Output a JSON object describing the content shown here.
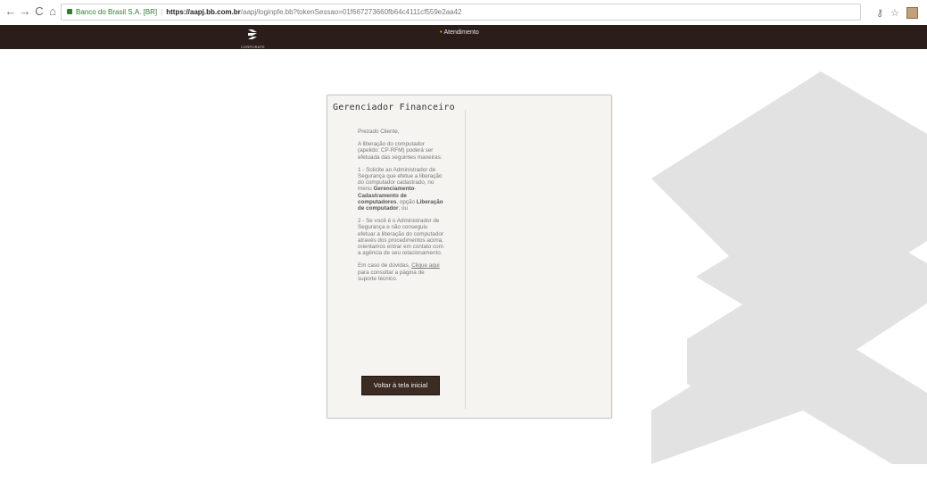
{
  "browser": {
    "back_icon": "←",
    "forward_icon": "→",
    "reload_icon": "C",
    "home_icon": "⌂",
    "site_identity": "Banco do Brasil S.A. [BR]",
    "url_host": "https://aapj.bb.com.br",
    "url_path": "/aapj/loginpfe.bb?tokenSessao=01f667273660fb64c4111cf559e2aa42",
    "key_icon": "⚷",
    "star_icon": "☆",
    "extension_icon": "extension-icon"
  },
  "header": {
    "logo_text": "CORPORATE",
    "menu_item": "Atendimento",
    "bg_color": "#2b1e1a",
    "accent_color": "#e7c300"
  },
  "panel": {
    "title": "Gerenciador Financeiro",
    "greeting": "Prezado Cliente,",
    "intro": "A liberação do computador (apelido: CP-RFM) poderá ser efetuada das seguintes maneiras:",
    "option1_a": "1 - Solicite ao Administrador de Segurança que efetue a liberação do computador cadastrado, no menu",
    "option1_b": "Gerenciamento",
    "option1_c": "Cadastramento de computadores",
    "option1_d": ", opção",
    "option1_e": "Liberação de computador",
    "option1_f": "; ou",
    "option2": "2 - Se você é o Administrador de Segurança e não conseguiu efetuar a liberação do computador através dos procedimentos acima, orientamos entrar em contato com a agência de seu relacionamento.",
    "help_a": "Em caso de dúvidas,",
    "help_link": "Clique aqui",
    "help_b": "para consultar a página de suporte técnico.",
    "back_button": "Voltar à tela inicial"
  }
}
